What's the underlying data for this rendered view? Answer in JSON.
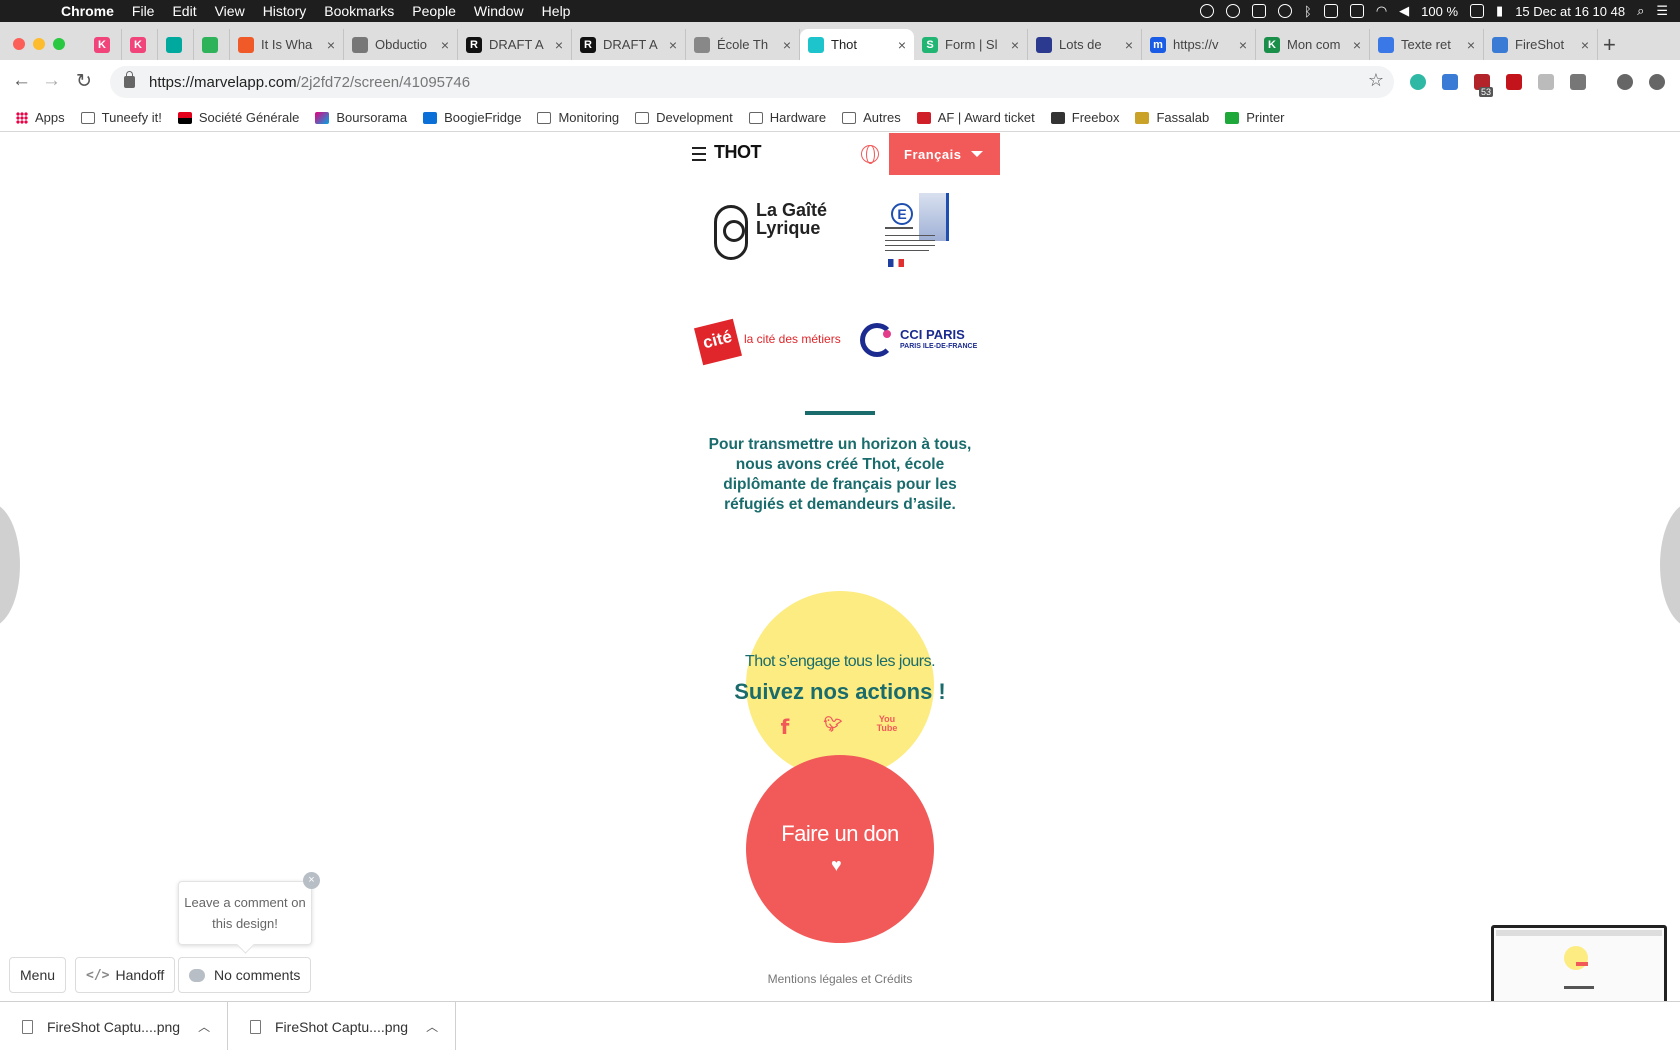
{
  "os_menubar": {
    "app": "Chrome",
    "items": [
      "File",
      "Edit",
      "View",
      "History",
      "Bookmarks",
      "People",
      "Window",
      "Help"
    ],
    "battery": "100 %",
    "datetime": "15 Dec at  16 10 48"
  },
  "tabs": [
    {
      "title": "",
      "favicon": "K",
      "color": "#f0447a"
    },
    {
      "title": "",
      "favicon": "K",
      "color": "#f0447a"
    },
    {
      "title": "",
      "favicon": "",
      "color": "#00a99d"
    },
    {
      "title": "",
      "favicon": "",
      "color": "#2fb35a"
    },
    {
      "title": "It Is Wha",
      "favicon": "",
      "color": "#f05a28"
    },
    {
      "title": "Obductio",
      "favicon": "",
      "color": "#777777"
    },
    {
      "title": "DRAFT A",
      "favicon": "R",
      "color": "#111111"
    },
    {
      "title": "DRAFT A",
      "favicon": "R",
      "color": "#111111"
    },
    {
      "title": "École Th",
      "favicon": "",
      "color": "#888888"
    },
    {
      "title": "Thot",
      "favicon": "",
      "color": "#1ec4cc",
      "active": true
    },
    {
      "title": "Form | Sl",
      "favicon": "S",
      "color": "#21b573"
    },
    {
      "title": "Lots de",
      "favicon": "",
      "color": "#2b3a8f"
    },
    {
      "title": "https://v",
      "favicon": "m",
      "color": "#1a5ce6"
    },
    {
      "title": "Mon com",
      "favicon": "K",
      "color": "#1a8f4a"
    },
    {
      "title": "Texte ret",
      "favicon": "",
      "color": "#3b78e7"
    },
    {
      "title": "FireShot",
      "favicon": "",
      "color": "#3a7bd5"
    }
  ],
  "address": {
    "host": "https://marvelapp.com",
    "path": "/2j2fd72/screen/41095746"
  },
  "extensions": {
    "badge": "53"
  },
  "bookmarks": [
    {
      "label": "Apps",
      "icon": "apps-icon"
    },
    {
      "label": "Tuneefy it!",
      "icon": "page-icon"
    },
    {
      "label": "Société Générale",
      "icon": "sg-icon"
    },
    {
      "label": "Boursorama",
      "icon": "boursorama-icon"
    },
    {
      "label": "BoogieFridge",
      "icon": "dsm-icon"
    },
    {
      "label": "Monitoring",
      "icon": "folder-icon"
    },
    {
      "label": "Development",
      "icon": "folder-icon"
    },
    {
      "label": "Hardware",
      "icon": "folder-icon"
    },
    {
      "label": "Autres",
      "icon": "folder-icon"
    },
    {
      "label": "AF | Award ticket",
      "icon": "af-icon"
    },
    {
      "label": "Freebox",
      "icon": "freebox-icon"
    },
    {
      "label": "Fassalab",
      "icon": "fassalab-icon"
    },
    {
      "label": "Printer",
      "icon": "printer-icon"
    }
  ],
  "site": {
    "logo": "THOT",
    "language": "Français",
    "partners": {
      "gaite": "La Gaîté Lyrique",
      "cite": "la cité des métiers",
      "cite_box": "cité",
      "cci_title": "CCI PARIS",
      "cci_subtitle": "PARIS ILE-DE-FRANCE"
    },
    "mission": "Pour transmettre un horizon à tous, nous avons créé Thot, école diplômante de français pour les réfugiés et demandeurs d’asile.",
    "engage_text": "Thot s’engage tous les jours.",
    "follow_title": "Suivez nos actions !",
    "social": {
      "facebook": "f",
      "twitter": "t",
      "youtube": "You Tube"
    },
    "donate_label": "Faire un don",
    "footer_link": "Mentions légales et Crédits"
  },
  "marvel": {
    "comment_tip": "Leave a comment on this design!",
    "menu_label": "Menu",
    "handoff_label": "Handoff",
    "comments_label": "No comments"
  },
  "downloads": [
    {
      "name": "FireShot Captu....png"
    },
    {
      "name": "FireShot Captu....png"
    }
  ],
  "colors": {
    "brand_red": "#f25a5a",
    "brand_teal": "#1a6b6b",
    "brand_yellow": "#fcec82"
  }
}
